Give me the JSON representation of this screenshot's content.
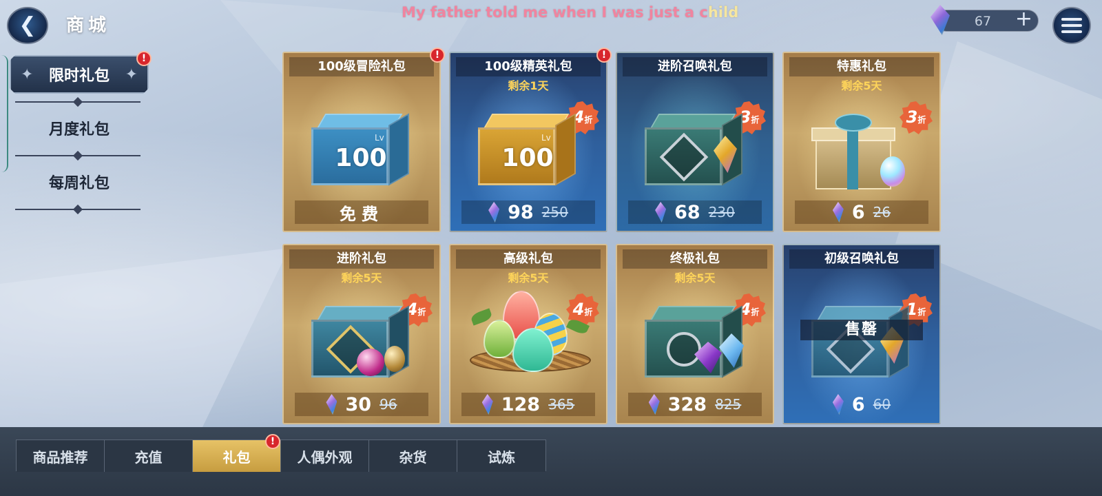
{
  "header": {
    "title": "商城",
    "subtitle_plain": "My father told me when I was just a c",
    "subtitle_highlight": "hild",
    "currency_amount": "67"
  },
  "sidebar": {
    "items": [
      {
        "label": "限时礼包",
        "active": true,
        "alert": "!"
      },
      {
        "label": "月度礼包",
        "active": false
      },
      {
        "label": "每周礼包",
        "active": false
      }
    ]
  },
  "cards": [
    {
      "title": "100级冒险礼包",
      "remain": "",
      "discount": "",
      "discount_unit": "",
      "lv_label": "Lv",
      "lv_value": "100",
      "price_free": "免费",
      "alert": "!",
      "theme": "gold"
    },
    {
      "title": "100级精英礼包",
      "remain": "剩余1天",
      "discount": "4",
      "discount_unit": "折",
      "lv_label": "Lv",
      "lv_value": "100",
      "price": "98",
      "original_price": "250",
      "alert": "!",
      "theme": "blue"
    },
    {
      "title": "进阶召唤礼包",
      "remain": "",
      "discount": "3",
      "discount_unit": "折",
      "price": "68",
      "original_price": "230",
      "theme": "teal"
    },
    {
      "title": "特惠礼包",
      "remain": "剩余5天",
      "discount": "3",
      "discount_unit": "折",
      "price": "6",
      "original_price": "26",
      "theme": "gold"
    },
    {
      "title": "进阶礼包",
      "remain": "剩余5天",
      "discount": "4",
      "discount_unit": "折",
      "price": "30",
      "original_price": "96",
      "theme": "gold"
    },
    {
      "title": "高级礼包",
      "remain": "剩余5天",
      "discount": "4",
      "discount_unit": "折",
      "price": "128",
      "original_price": "365",
      "theme": "gold"
    },
    {
      "title": "终极礼包",
      "remain": "剩余5天",
      "discount": "4",
      "discount_unit": "折",
      "price": "328",
      "original_price": "825",
      "theme": "gold"
    },
    {
      "title": "初级召唤礼包",
      "remain": "",
      "discount": "1",
      "discount_unit": "折",
      "price": "6",
      "original_price": "60",
      "soldout": "售罄",
      "theme": "blue"
    }
  ],
  "bottom_tabs": [
    {
      "label": "商品推荐",
      "active": false
    },
    {
      "label": "充值",
      "active": false
    },
    {
      "label": "礼包",
      "active": true,
      "alert": "!"
    },
    {
      "label": "人偶外观",
      "active": false
    },
    {
      "label": "杂货",
      "active": false
    },
    {
      "label": "试炼",
      "active": false
    }
  ],
  "icons": {
    "back": "back-arrow-icon",
    "menu": "hamburger-menu-icon",
    "gem": "crystal-gem-icon",
    "plus": "plus-icon"
  },
  "colors": {
    "subtitle_pink": "#f0849f",
    "subtitle_highlight": "#f6e6a0",
    "discount_badge": "#e8643a",
    "remain_text": "#ffd55a",
    "active_tab": "#d8b456",
    "alert_red": "#d8262c"
  }
}
